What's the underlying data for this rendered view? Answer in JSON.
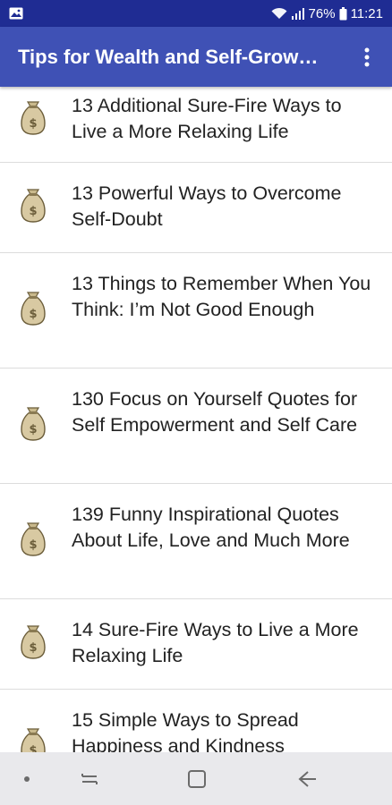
{
  "status_bar": {
    "battery": "76%",
    "time": "11:21",
    "icons": [
      "gallery-icon",
      "wifi-icon",
      "signal-icon",
      "battery-icon"
    ]
  },
  "app_bar": {
    "title": "Tips for Wealth and Self-Grow…",
    "menu_icon": "overflow-menu-icon"
  },
  "articles": [
    {
      "title": "13 Additional Sure-Fire Ways to Live a More Relaxing Life",
      "icon": "money-bag-icon"
    },
    {
      "title": "13 Powerful Ways to Overcome Self-Doubt",
      "icon": "money-bag-icon"
    },
    {
      "title": "13 Things to Remember When You Think: I’m Not Good Enough",
      "icon": "money-bag-icon"
    },
    {
      "title": "130 Focus on Yourself Quotes for Self Empowerment and Self Care",
      "icon": "money-bag-icon"
    },
    {
      "title": "139 Funny Inspirational Quotes About Life, Love and Much More",
      "icon": "money-bag-icon"
    },
    {
      "title": "14 Sure-Fire Ways to Live a More Relaxing Life",
      "icon": "money-bag-icon"
    },
    {
      "title": "15 Simple Ways to Spread Happiness and Kindness",
      "icon": "money-bag-icon"
    }
  ],
  "nav_bar": {
    "buttons": [
      "nav-dot-icon",
      "recents-icon",
      "home-icon",
      "back-icon"
    ]
  },
  "colors": {
    "status_bar": "#1f2c93",
    "app_bar": "#3f51b5",
    "divider": "#dcdcdc",
    "nav_bar": "#e9e9ec"
  }
}
